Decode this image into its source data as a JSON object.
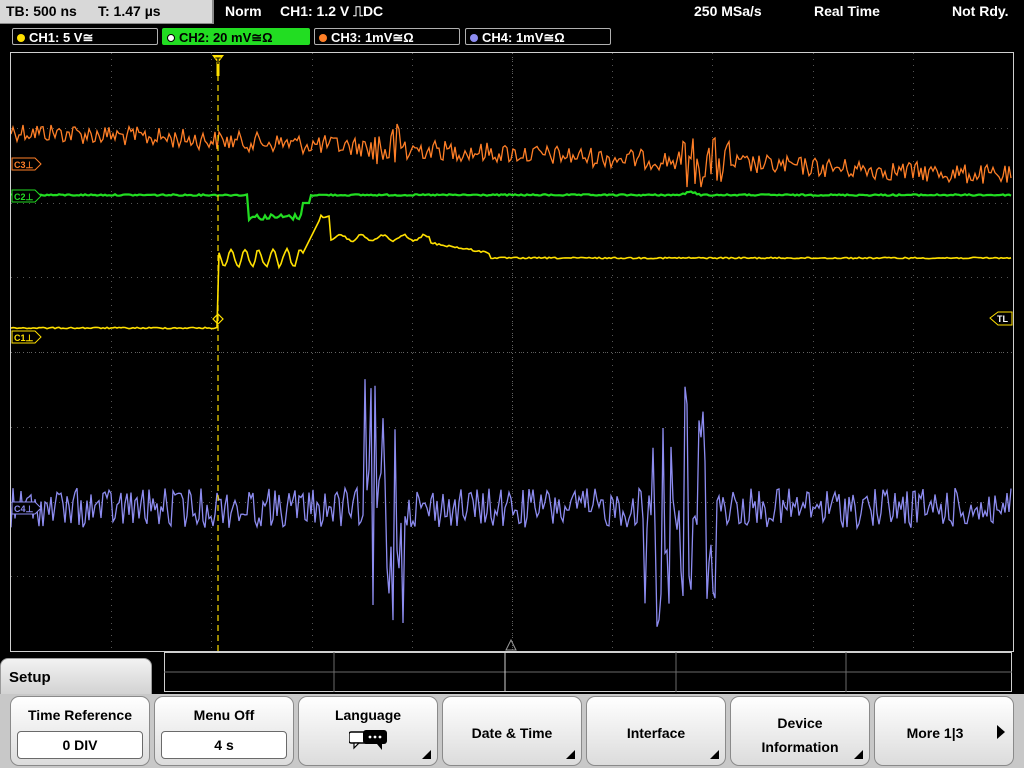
{
  "status": {
    "timebase": "TB: 500 ns",
    "trigger_time": "T: 1.47 µs",
    "mode": "Norm",
    "trigger": "CH1: 1.2 V ⎍DC",
    "sample_rate": "250 MSa/s",
    "acq_mode": "Real Time",
    "state": "Not Rdy."
  },
  "channels": [
    {
      "label": "CH1: 5 V≅",
      "color": "#ffe000",
      "active": false
    },
    {
      "label": "CH2: 20 mV≅Ω",
      "color": "#22dd22",
      "active": true
    },
    {
      "label": "CH3: 1mV≅Ω",
      "color": "#ff7f27",
      "active": false
    },
    {
      "label": "CH4: 1mV≅Ω",
      "color": "#8d8cf0",
      "active": false
    }
  ],
  "markers": {
    "c1": "C1⊥",
    "c2": "C2⊥",
    "c3": "C3⊥",
    "c4": "C4⊥",
    "trigger_level": "TL"
  },
  "menu": {
    "title": "Setup",
    "keys": [
      {
        "label": "Time Reference",
        "value": "0 DIV"
      },
      {
        "label": "Menu Off",
        "value": "4 s"
      },
      {
        "label": "Language",
        "icon": "speech-bubbles-icon"
      },
      {
        "label": "Date & Time"
      },
      {
        "label": "Interface"
      },
      {
        "label": "Device",
        "label2": "Information"
      },
      {
        "label": "More 1|3"
      }
    ]
  }
}
